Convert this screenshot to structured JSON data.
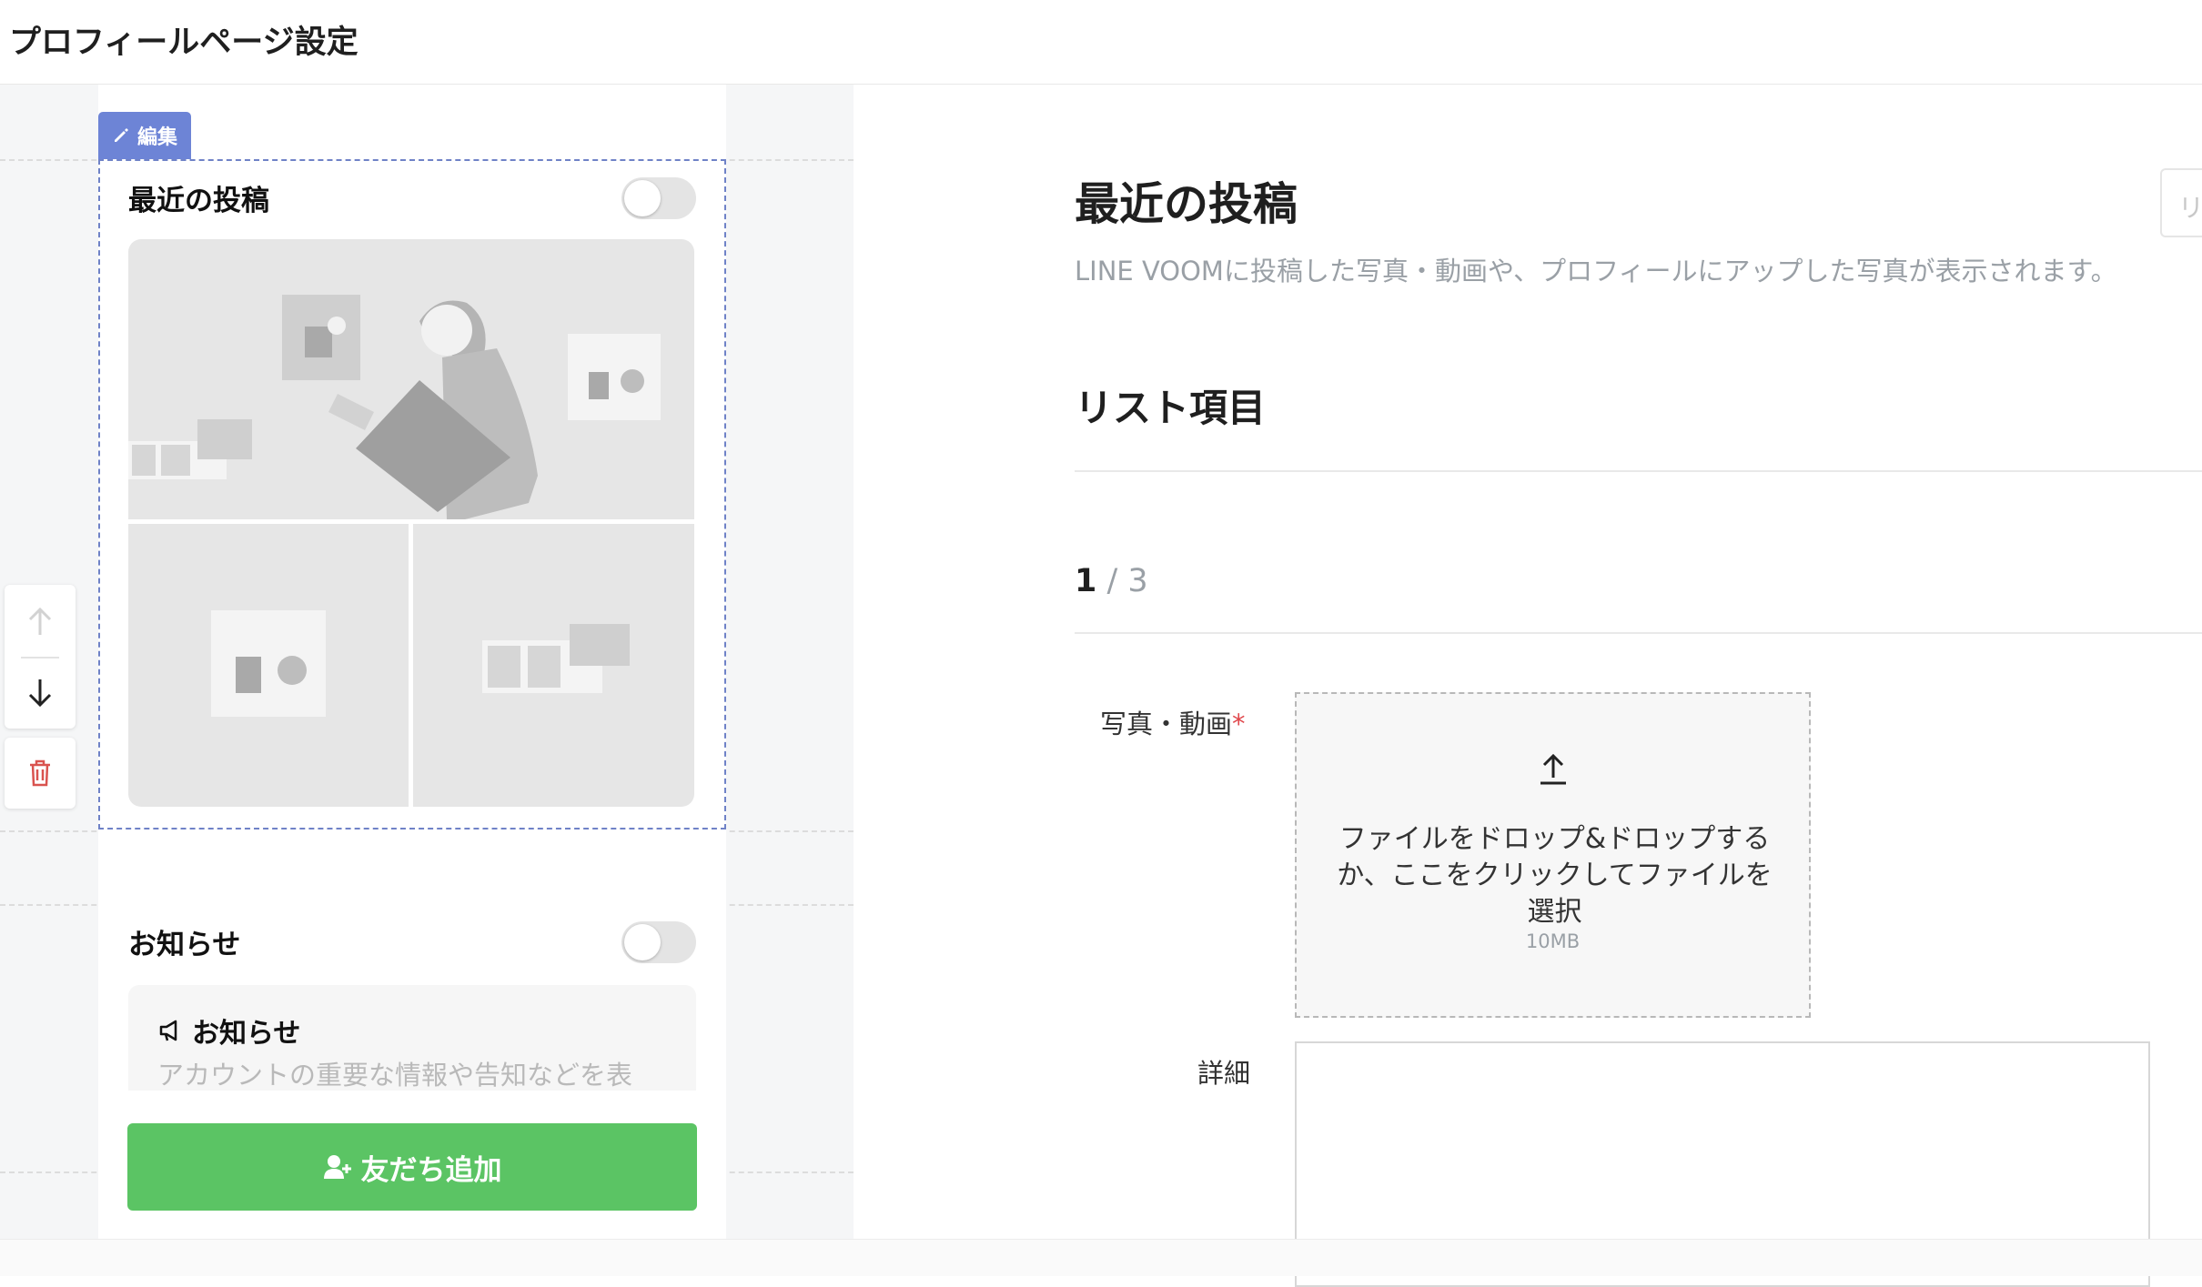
{
  "header": {
    "title": "プロフィールページ設定"
  },
  "editor": {
    "edit_tab_label": "編集",
    "recent_posts": {
      "title": "最近の投稿",
      "enabled": false
    },
    "notice": {
      "title": "お知らせ",
      "enabled": false,
      "card_title": "お知らせ",
      "card_desc": "アカウントの重要な情報や告知などを表"
    },
    "add_friend_label": "友だち追加"
  },
  "panel": {
    "title": "最近の投稿",
    "description": "LINE VOOMに投稿した写真・動画や、プロフィールにアップした写真が表示されます。",
    "list_title": "リスト項目",
    "pager": {
      "current": "1",
      "total": "/ 3"
    },
    "cut_button": "リ",
    "media_field": {
      "label": "写真・動画",
      "required_mark": "*",
      "dropzone_text": "ファイルをドロップ&ドロップするか、ここをクリックしてファイルを選択",
      "size_limit": "10MB"
    },
    "detail_field": {
      "label": "詳細",
      "value": ""
    }
  },
  "colors": {
    "accent_edit": "#6d84d6",
    "add_friend_green": "#5bc464",
    "delete_red": "#d9534f"
  },
  "icons": [
    "pencil-icon",
    "arrow-up-icon",
    "arrow-down-icon",
    "trash-icon",
    "megaphone-icon",
    "add-user-icon",
    "upload-icon"
  ]
}
